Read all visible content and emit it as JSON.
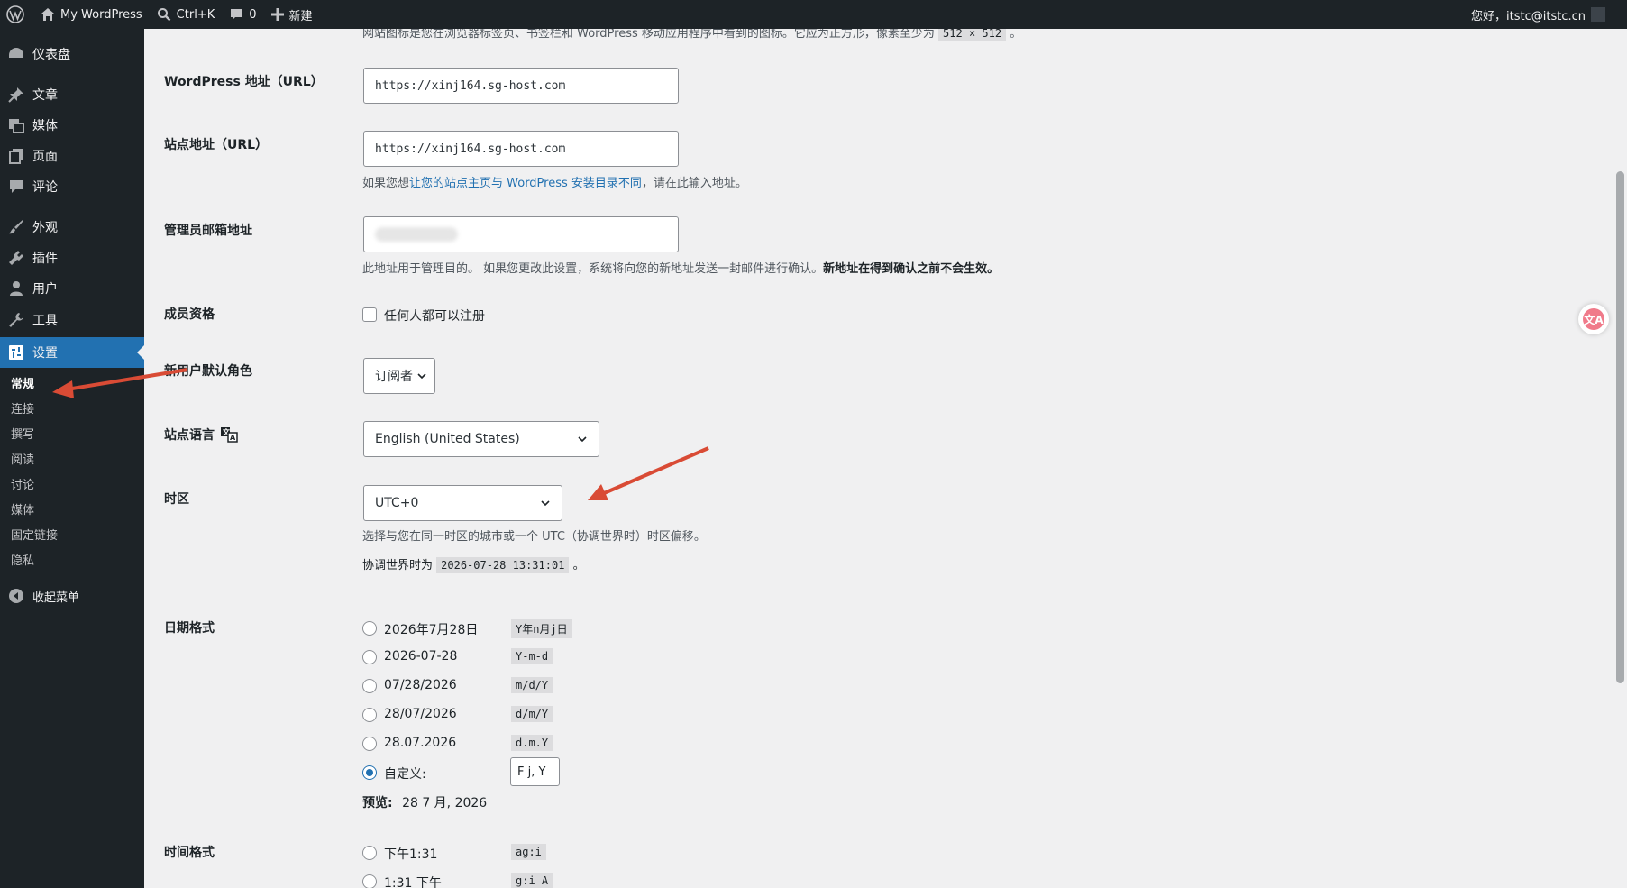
{
  "admin_bar": {
    "site_name": "My WordPress",
    "search_shortcut": "Ctrl+K",
    "comment_count": "0",
    "new_label": "新建",
    "greeting": "您好，itstc@itstc.cn"
  },
  "menu": {
    "items": [
      {
        "label": "仪表盘",
        "icon": "dashboard-icon"
      },
      {
        "label": "文章",
        "icon": "pin-icon"
      },
      {
        "label": "媒体",
        "icon": "media-icon"
      },
      {
        "label": "页面",
        "icon": "page-icon"
      },
      {
        "label": "评论",
        "icon": "comment-icon"
      },
      {
        "label": "外观",
        "icon": "brush-icon"
      },
      {
        "label": "插件",
        "icon": "plugin-icon"
      },
      {
        "label": "用户",
        "icon": "user-icon"
      },
      {
        "label": "工具",
        "icon": "wrench-icon"
      },
      {
        "label": "设置",
        "icon": "settings-icon"
      }
    ],
    "submenu": [
      "常规",
      "连接",
      "撰写",
      "阅读",
      "讨论",
      "媒体",
      "固定链接",
      "隐私"
    ],
    "collapse_label": "收起菜单"
  },
  "form": {
    "icon_desc_prefix": "网站图标是您在浏览器标签页、书签栏和 WordPress 移动应用程序中看到的图标。它应为正方形，像素至少为",
    "icon_size_code": "512 × 512",
    "icon_desc_suffix": "。",
    "wp_url_label": "WordPress 地址（URL）",
    "wp_url_value": "https://xinj164.sg-host.com",
    "site_url_label": "站点地址（URL）",
    "site_url_value": "https://xinj164.sg-host.com",
    "site_url_desc_prefix": "如果您想",
    "site_url_desc_link": "让您的站点主页与 WordPress 安装目录不同",
    "site_url_desc_suffix": "，请在此输入地址。",
    "admin_email_label": "管理员邮箱地址",
    "admin_email_desc": "此地址用于管理目的。 如果您更改此设置，系统将向您的新地址发送一封邮件进行确认。",
    "admin_email_desc_bold": "新地址在得到确认之前不会生效。",
    "membership_label": "成员资格",
    "membership_option": "任何人都可以注册",
    "default_role_label": "新用户默认角色",
    "default_role_value": "订阅者",
    "language_label": "站点语言",
    "language_value": "English (United States)",
    "timezone_label": "时区",
    "timezone_value": "UTC+0",
    "timezone_desc": "选择与您在同一时区的城市或一个 UTC（协调世界时）时区偏移。",
    "utc_time_prefix": "协调世界时为",
    "utc_time_value": "2026-07-28 13:31:01",
    "utc_time_suffix": "。",
    "date_format_label": "日期格式",
    "date_formats": [
      {
        "label": "2026年7月28日",
        "code": "Y年n月j日"
      },
      {
        "label": "2026-07-28",
        "code": "Y-m-d"
      },
      {
        "label": "07/28/2026",
        "code": "m/d/Y"
      },
      {
        "label": "28/07/2026",
        "code": "d/m/Y"
      },
      {
        "label": "28.07.2026",
        "code": "d.m.Y"
      }
    ],
    "custom_label": "自定义:",
    "custom_value": "F j, Y",
    "preview_label": "预览:",
    "preview_value": "28 7 月, 2026",
    "time_format_label": "时间格式",
    "time_formats": [
      {
        "label": "下午1:31",
        "code": "ag:i"
      },
      {
        "label": "1:31 下午",
        "code": "g:i A"
      }
    ]
  },
  "translate_fab_glyph": "文A",
  "colors": {
    "accent": "#2271b1",
    "menu_bg": "#1d2327",
    "annotation_arrow": "#d94b35"
  }
}
